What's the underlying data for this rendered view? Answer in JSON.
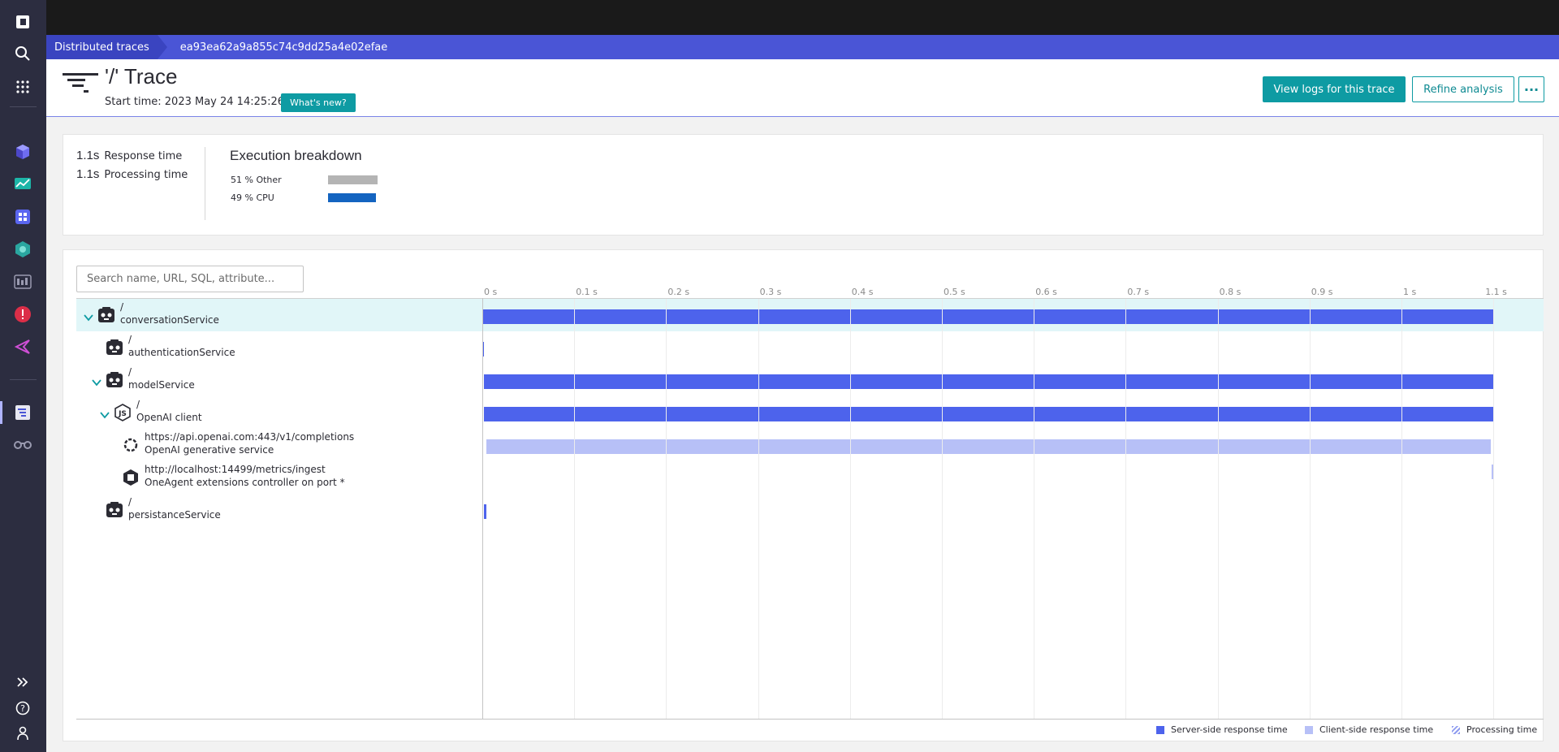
{
  "nav": {
    "icons": [
      "dynatrace-logo-icon",
      "search-icon",
      "apps-grid-icon",
      "cube-icon",
      "infrastructure-icon",
      "dashboard-icon",
      "hub-icon",
      "metrics-icon",
      "problems-icon",
      "workflows-icon",
      "distributed-traces-icon",
      "observe-icon",
      "expand-icon",
      "help-icon",
      "user-icon"
    ]
  },
  "breadcrumb": {
    "root": "Distributed traces",
    "current": "ea93ea62a9a855c74c9dd25a4e02efae"
  },
  "header": {
    "title": "'/' Trace",
    "start_time": "Start time: 2023 May 24 14:25:26",
    "whats_new": "What's new?",
    "view_logs": "View logs for this trace",
    "refine": "Refine analysis",
    "more": "···"
  },
  "summary": {
    "response_value": "1.1s",
    "response_label": "Response time",
    "processing_value": "1.1s",
    "processing_label": "Processing time",
    "breakdown_title": "Execution breakdown",
    "breakdown": [
      {
        "label": "51 % Other",
        "percent": 51,
        "color": "#b4b4b4"
      },
      {
        "label": "49 % CPU",
        "percent": 49,
        "color": "#1464c0"
      }
    ]
  },
  "waterfall": {
    "search_placeholder": "Search name, URL, SQL, attribute...",
    "ticks": [
      "0 s",
      "0.1 s",
      "0.2 s",
      "0.3 s",
      "0.4 s",
      "0.5 s",
      "0.6 s",
      "0.7 s",
      "0.8 s",
      "0.9 s",
      "1 s",
      "1.1 s"
    ],
    "rows": [
      {
        "name": "/",
        "sub": "conversationService",
        "icon": "service-icon",
        "expand": true,
        "start": 0.0,
        "end": 1.1,
        "kind": "server"
      },
      {
        "name": "/",
        "sub": "authenticationService",
        "icon": "service-icon",
        "expand": false,
        "start": 0.0,
        "end": 0.002,
        "kind": "server"
      },
      {
        "name": "/",
        "sub": "modelService",
        "icon": "service-icon",
        "expand": true,
        "start": 0.002,
        "end": 1.1,
        "kind": "server"
      },
      {
        "name": "/",
        "sub": "OpenAI client",
        "icon": "nodejs-icon",
        "expand": true,
        "start": 0.002,
        "end": 1.1,
        "kind": "server"
      },
      {
        "name": "https://api.openai.com:443/v1/completions",
        "sub": "OpenAI generative service",
        "icon": "openai-icon",
        "expand": false,
        "start": 0.004,
        "end": 1.097,
        "kind": "client"
      },
      {
        "name": "http://localhost:14499/metrics/ingest",
        "sub": "OneAgent extensions controller on port *",
        "icon": "extension-icon",
        "expand": false,
        "start": 1.098,
        "end": 1.101,
        "kind": "client"
      },
      {
        "name": "/",
        "sub": "persistanceService",
        "icon": "service-icon",
        "expand": false,
        "start": 0.002,
        "end": 0.004,
        "kind": "server"
      }
    ],
    "legend": {
      "server": "Server-side response time",
      "client": "Client-side response time",
      "processing": "Processing time"
    },
    "colors": {
      "server": "#4d63ec",
      "client": "#b7c0f7",
      "processing": "#8f9cf0"
    }
  }
}
